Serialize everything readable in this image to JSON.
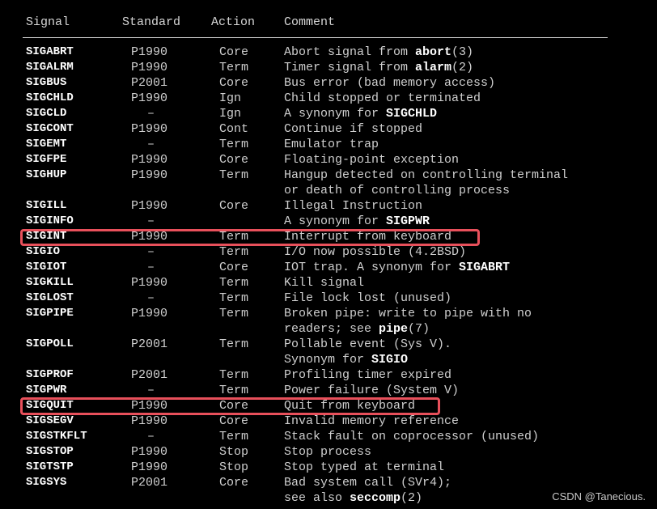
{
  "header": {
    "signal": "Signal",
    "standard": "Standard",
    "action": "Action",
    "comment": "Comment"
  },
  "rows": [
    {
      "signal": "SIGABRT",
      "standard": "P1990",
      "action": "Core",
      "comment": [
        {
          "t": "Abort signal from "
        },
        {
          "t": "abort",
          "b": true
        },
        {
          "t": "(3)"
        }
      ]
    },
    {
      "signal": "SIGALRM",
      "standard": "P1990",
      "action": "Term",
      "comment": [
        {
          "t": "Timer signal from "
        },
        {
          "t": "alarm",
          "b": true
        },
        {
          "t": "(2)"
        }
      ]
    },
    {
      "signal": "SIGBUS",
      "standard": "P2001",
      "action": "Core",
      "comment": [
        {
          "t": "Bus error (bad memory access)"
        }
      ]
    },
    {
      "signal": "SIGCHLD",
      "standard": "P1990",
      "action": "Ign",
      "comment": [
        {
          "t": "Child stopped or terminated"
        }
      ]
    },
    {
      "signal": "SIGCLD",
      "standard": "–",
      "action": "Ign",
      "comment": [
        {
          "t": "A synonym for "
        },
        {
          "t": "SIGCHLD",
          "b": true
        }
      ]
    },
    {
      "signal": "SIGCONT",
      "standard": "P1990",
      "action": "Cont",
      "comment": [
        {
          "t": "Continue if stopped"
        }
      ]
    },
    {
      "signal": "SIGEMT",
      "standard": "–",
      "action": "Term",
      "comment": [
        {
          "t": "Emulator trap"
        }
      ]
    },
    {
      "signal": "SIGFPE",
      "standard": "P1990",
      "action": "Core",
      "comment": [
        {
          "t": "Floating-point exception"
        }
      ]
    },
    {
      "signal": "SIGHUP",
      "standard": "P1990",
      "action": "Term",
      "comment": [
        {
          "t": "Hangup detected on controlling terminal"
        }
      ]
    },
    {
      "signal": "",
      "standard": "",
      "action": "",
      "comment": [
        {
          "t": "or death of controlling process"
        }
      ]
    },
    {
      "signal": "SIGILL",
      "standard": "P1990",
      "action": "Core",
      "comment": [
        {
          "t": "Illegal Instruction"
        }
      ]
    },
    {
      "signal": "SIGINFO",
      "standard": "–",
      "action": "",
      "comment": [
        {
          "t": "A synonym for "
        },
        {
          "t": "SIGPWR",
          "b": true
        }
      ]
    },
    {
      "signal": "SIGINT",
      "standard": "P1990",
      "action": "Term",
      "comment": [
        {
          "t": "Interrupt from keyboard"
        }
      ],
      "highlight": true
    },
    {
      "signal": "SIGIO",
      "standard": "–",
      "action": "Term",
      "comment": [
        {
          "t": "I/O now possible (4.2BSD)"
        }
      ]
    },
    {
      "signal": "SIGIOT",
      "standard": "–",
      "action": "Core",
      "comment": [
        {
          "t": "IOT trap. A synonym for "
        },
        {
          "t": "SIGABRT",
          "b": true
        }
      ]
    },
    {
      "signal": "SIGKILL",
      "standard": "P1990",
      "action": "Term",
      "comment": [
        {
          "t": "Kill signal"
        }
      ]
    },
    {
      "signal": "SIGLOST",
      "standard": "–",
      "action": "Term",
      "comment": [
        {
          "t": "File lock lost (unused)"
        }
      ]
    },
    {
      "signal": "SIGPIPE",
      "standard": "P1990",
      "action": "Term",
      "comment": [
        {
          "t": "Broken pipe: write to pipe with no"
        }
      ]
    },
    {
      "signal": "",
      "standard": "",
      "action": "",
      "comment": [
        {
          "t": "readers; see "
        },
        {
          "t": "pipe",
          "b": true
        },
        {
          "t": "(7)"
        }
      ]
    },
    {
      "signal": "SIGPOLL",
      "standard": "P2001",
      "action": "Term",
      "comment": [
        {
          "t": "Pollable event (Sys V)."
        }
      ]
    },
    {
      "signal": "",
      "standard": "",
      "action": "",
      "comment": [
        {
          "t": "Synonym for "
        },
        {
          "t": "SIGIO",
          "b": true
        }
      ]
    },
    {
      "signal": "SIGPROF",
      "standard": "P2001",
      "action": "Term",
      "comment": [
        {
          "t": "Profiling timer expired"
        }
      ]
    },
    {
      "signal": "SIGPWR",
      "standard": "–",
      "action": "Term",
      "comment": [
        {
          "t": "Power failure (System V)"
        }
      ]
    },
    {
      "signal": "SIGQUIT",
      "standard": "P1990",
      "action": "Core",
      "comment": [
        {
          "t": "Quit from keyboard"
        }
      ],
      "highlight": true
    },
    {
      "signal": "SIGSEGV",
      "standard": "P1990",
      "action": "Core",
      "comment": [
        {
          "t": "Invalid memory reference"
        }
      ]
    },
    {
      "signal": "SIGSTKFLT",
      "standard": "–",
      "action": "Term",
      "comment": [
        {
          "t": "Stack fault on coprocessor (unused)"
        }
      ]
    },
    {
      "signal": "SIGSTOP",
      "standard": "P1990",
      "action": "Stop",
      "comment": [
        {
          "t": "Stop process"
        }
      ]
    },
    {
      "signal": "SIGTSTP",
      "standard": "P1990",
      "action": "Stop",
      "comment": [
        {
          "t": "Stop typed at terminal"
        }
      ]
    },
    {
      "signal": "SIGSYS",
      "standard": "P2001",
      "action": "Core",
      "comment": [
        {
          "t": "Bad system call (SVr4);"
        }
      ]
    },
    {
      "signal": "",
      "standard": "",
      "action": "",
      "comment": [
        {
          "t": "see also "
        },
        {
          "t": "seccomp",
          "b": true
        },
        {
          "t": "(2)"
        }
      ]
    }
  ],
  "watermark": "CSDN @Tanecious.",
  "colors": {
    "background": "#000000",
    "text": "#cfcfcf",
    "highlight_border": "#e8505b"
  }
}
